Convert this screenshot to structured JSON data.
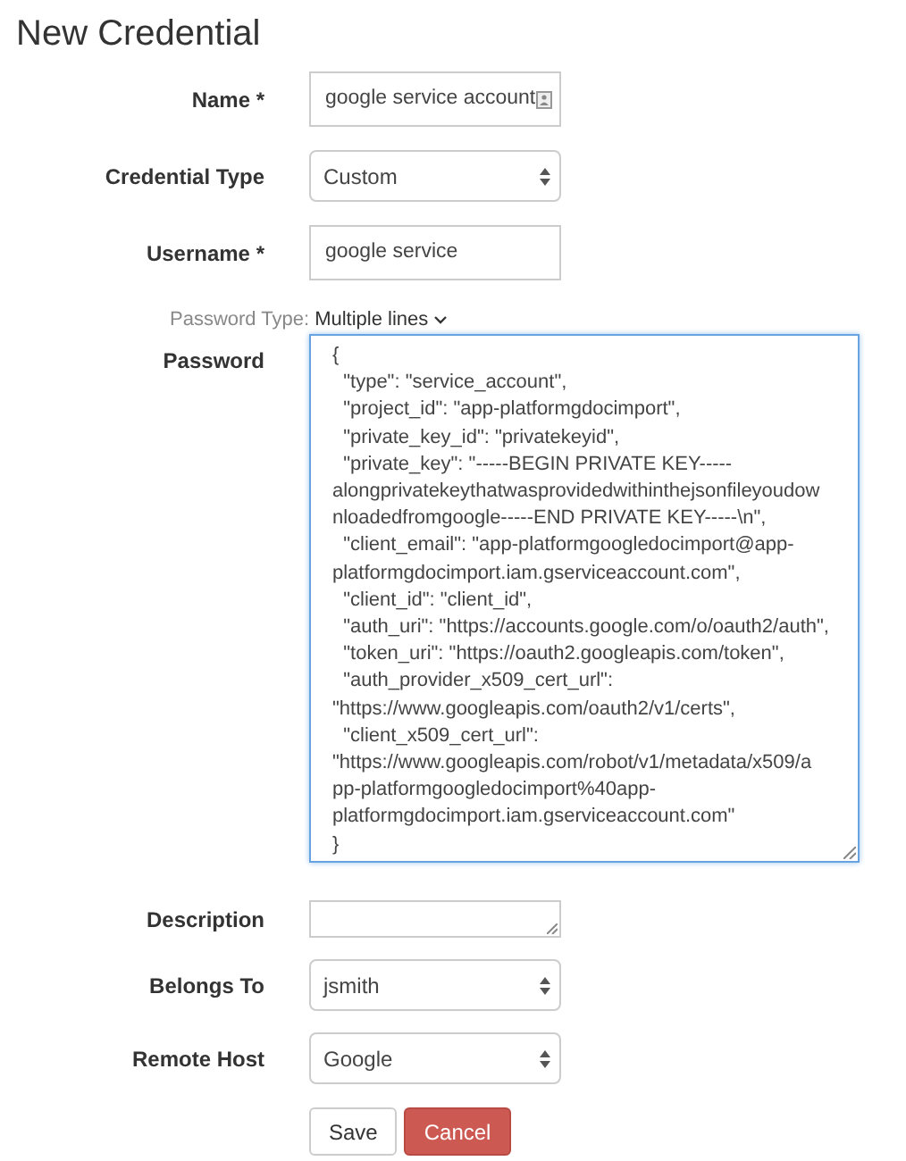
{
  "title": "New Credential",
  "fields": [
    {
      "kind": "text",
      "label": "Name *",
      "value": "google service account",
      "autofill_icon": true
    },
    {
      "kind": "select",
      "label": "Credential Type",
      "value": "Custom"
    },
    {
      "kind": "text",
      "label": "Username *",
      "value": "google service"
    }
  ],
  "password_type": {
    "label": "Password Type:",
    "value": "Multiple lines"
  },
  "password": {
    "label": "Password",
    "lines": [
      "{",
      "  \"type\": \"service_account\",",
      "  \"project_id\": \"app-platformgdocimport\",",
      "  \"private_key_id\": \"privatekeyid\",",
      "  \"private_key\": \"-----BEGIN PRIVATE KEY-----",
      "alongprivatekeythatwasprovidedwithinthejsonfileyoudow",
      "nloadedfromgoogle-----END PRIVATE KEY-----\\n\",",
      "  \"client_email\": \"app-platformgoogledocimport@app-",
      "platformgdocimport.iam.gserviceaccount.com\",",
      "  \"client_id\": \"client_id\",",
      "  \"auth_uri\": \"https://accounts.google.com/o/oauth2/auth\",",
      "  \"token_uri\": \"https://oauth2.googleapis.com/token\",",
      "  \"auth_provider_x509_cert_url\":",
      "\"https://www.googleapis.com/oauth2/v1/certs\",",
      "  \"client_x509_cert_url\":",
      "\"https://www.googleapis.com/robot/v1/metadata/x509/a",
      "pp-platformgoogledocimport%40app-",
      "platformgdocimport.iam.gserviceaccount.com\"",
      "}"
    ]
  },
  "fields_2": [
    {
      "kind": "textarea",
      "label": "Description"
    },
    {
      "kind": "select",
      "label": "Belongs To",
      "value": "jsmith"
    },
    {
      "kind": "select",
      "label": "Remote Host",
      "value": "Google"
    }
  ],
  "buttons": [
    {
      "kind": "default",
      "label": "Save"
    },
    {
      "kind": "danger",
      "label": "Cancel"
    }
  ]
}
